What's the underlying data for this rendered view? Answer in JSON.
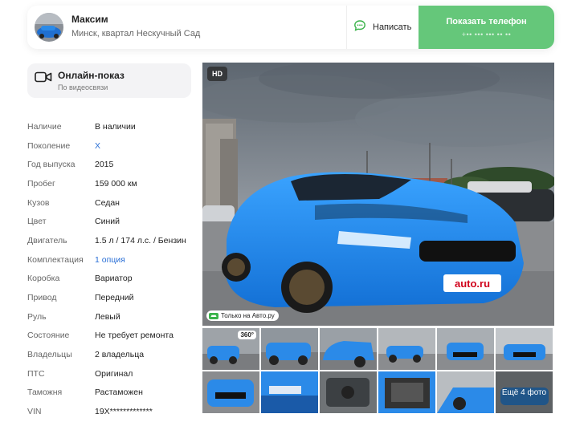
{
  "seller": {
    "name": "Максим",
    "location": "Минск, квартал Нескучный Сад",
    "write_label": "Написать",
    "phone_label": "Показать телефон",
    "phone_masked": "+•• ••• ••• •• ••"
  },
  "online_show": {
    "title": "Онлайн-показ",
    "subtitle": "По видеосвязи"
  },
  "specs": [
    {
      "key": "Наличие",
      "value": "В наличии",
      "link": false
    },
    {
      "key": "Поколение",
      "value": "X",
      "link": true
    },
    {
      "key": "Год выпуска",
      "value": "2015",
      "link": false
    },
    {
      "key": "Пробег",
      "value": "159 000 км",
      "link": false
    },
    {
      "key": "Кузов",
      "value": "Седан",
      "link": false
    },
    {
      "key": "Цвет",
      "value": "Синий",
      "link": false
    },
    {
      "key": "Двигатель",
      "value": "1.5 л / 174 л.с. / Бензин",
      "link": false
    },
    {
      "key": "Комплектация",
      "value": "1 опция",
      "link": true
    },
    {
      "key": "Коробка",
      "value": "Вариатор",
      "link": false
    },
    {
      "key": "Привод",
      "value": "Передний",
      "link": false
    },
    {
      "key": "Руль",
      "value": "Левый",
      "link": false
    },
    {
      "key": "Состояние",
      "value": "Не требует ремонта",
      "link": false
    },
    {
      "key": "Владельцы",
      "value": "2 владельца",
      "link": false
    },
    {
      "key": "ПТС",
      "value": "Оригинал",
      "link": false
    },
    {
      "key": "Таможня",
      "value": "Растаможен",
      "link": false
    },
    {
      "key": "VIN",
      "value": "19X*************",
      "link": false
    }
  ],
  "gallery": {
    "hd_label": "HD",
    "only_label": "Только на Авто.ру",
    "plate_text": "auto.ru",
    "badge_360": "360°",
    "more_label": "Ещё 4 фото"
  },
  "colors": {
    "accent_green": "#65c77a",
    "link_blue": "#2a6fd6",
    "car_blue": "#1f8fe8"
  }
}
